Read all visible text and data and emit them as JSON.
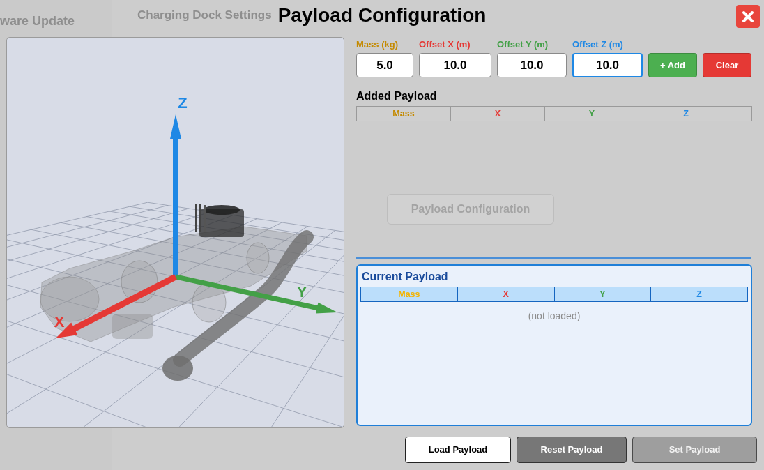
{
  "background_page": {
    "sidebar_item": "ware Update",
    "title": "Charging Dock Settings",
    "button": "Payload Configuration"
  },
  "dialog": {
    "title": "Payload Configuration"
  },
  "viewport": {
    "axes": [
      {
        "label": "Z",
        "color": "#1e88e5"
      },
      {
        "label": "Y",
        "color": "#43a047"
      },
      {
        "label": "X",
        "color": "#e53935"
      }
    ]
  },
  "fields": [
    {
      "label": "Mass (kg)",
      "color": "#c48a00",
      "value": "5.0",
      "focused": false
    },
    {
      "label": "Offset X (m)",
      "color": "#e53935",
      "value": "10.0",
      "focused": false
    },
    {
      "label": "Offset Y (m)",
      "color": "#43a047",
      "value": "10.0",
      "focused": false
    },
    {
      "label": "Offset Z (m)",
      "color": "#1e88e5",
      "value": "10.0",
      "focused": true
    }
  ],
  "actions": [
    {
      "label": "+ Add",
      "kind": "add"
    },
    {
      "label": "Clear",
      "kind": "clear"
    }
  ],
  "added_payload": {
    "title": "Added Payload",
    "columns": [
      {
        "label": "Mass",
        "color": "#c48a00"
      },
      {
        "label": "X",
        "color": "#e53935"
      },
      {
        "label": "Y",
        "color": "#43a047"
      },
      {
        "label": "Z",
        "color": "#1e88e5"
      }
    ]
  },
  "current_payload": {
    "title": "Current Payload",
    "columns": [
      {
        "label": "Mass",
        "color": "#f4b400"
      },
      {
        "label": "X",
        "color": "#e53935"
      },
      {
        "label": "Y",
        "color": "#43a047"
      },
      {
        "label": "Z",
        "color": "#1e88e5"
      }
    ],
    "empty_text": "(not loaded)"
  },
  "footer_buttons": [
    {
      "label": "Load Payload",
      "kind": "outline",
      "disabled": false
    },
    {
      "label": "Reset Payload",
      "kind": "filled",
      "disabled": false
    },
    {
      "label": "Set Payload",
      "kind": "filled",
      "disabled": true
    }
  ]
}
